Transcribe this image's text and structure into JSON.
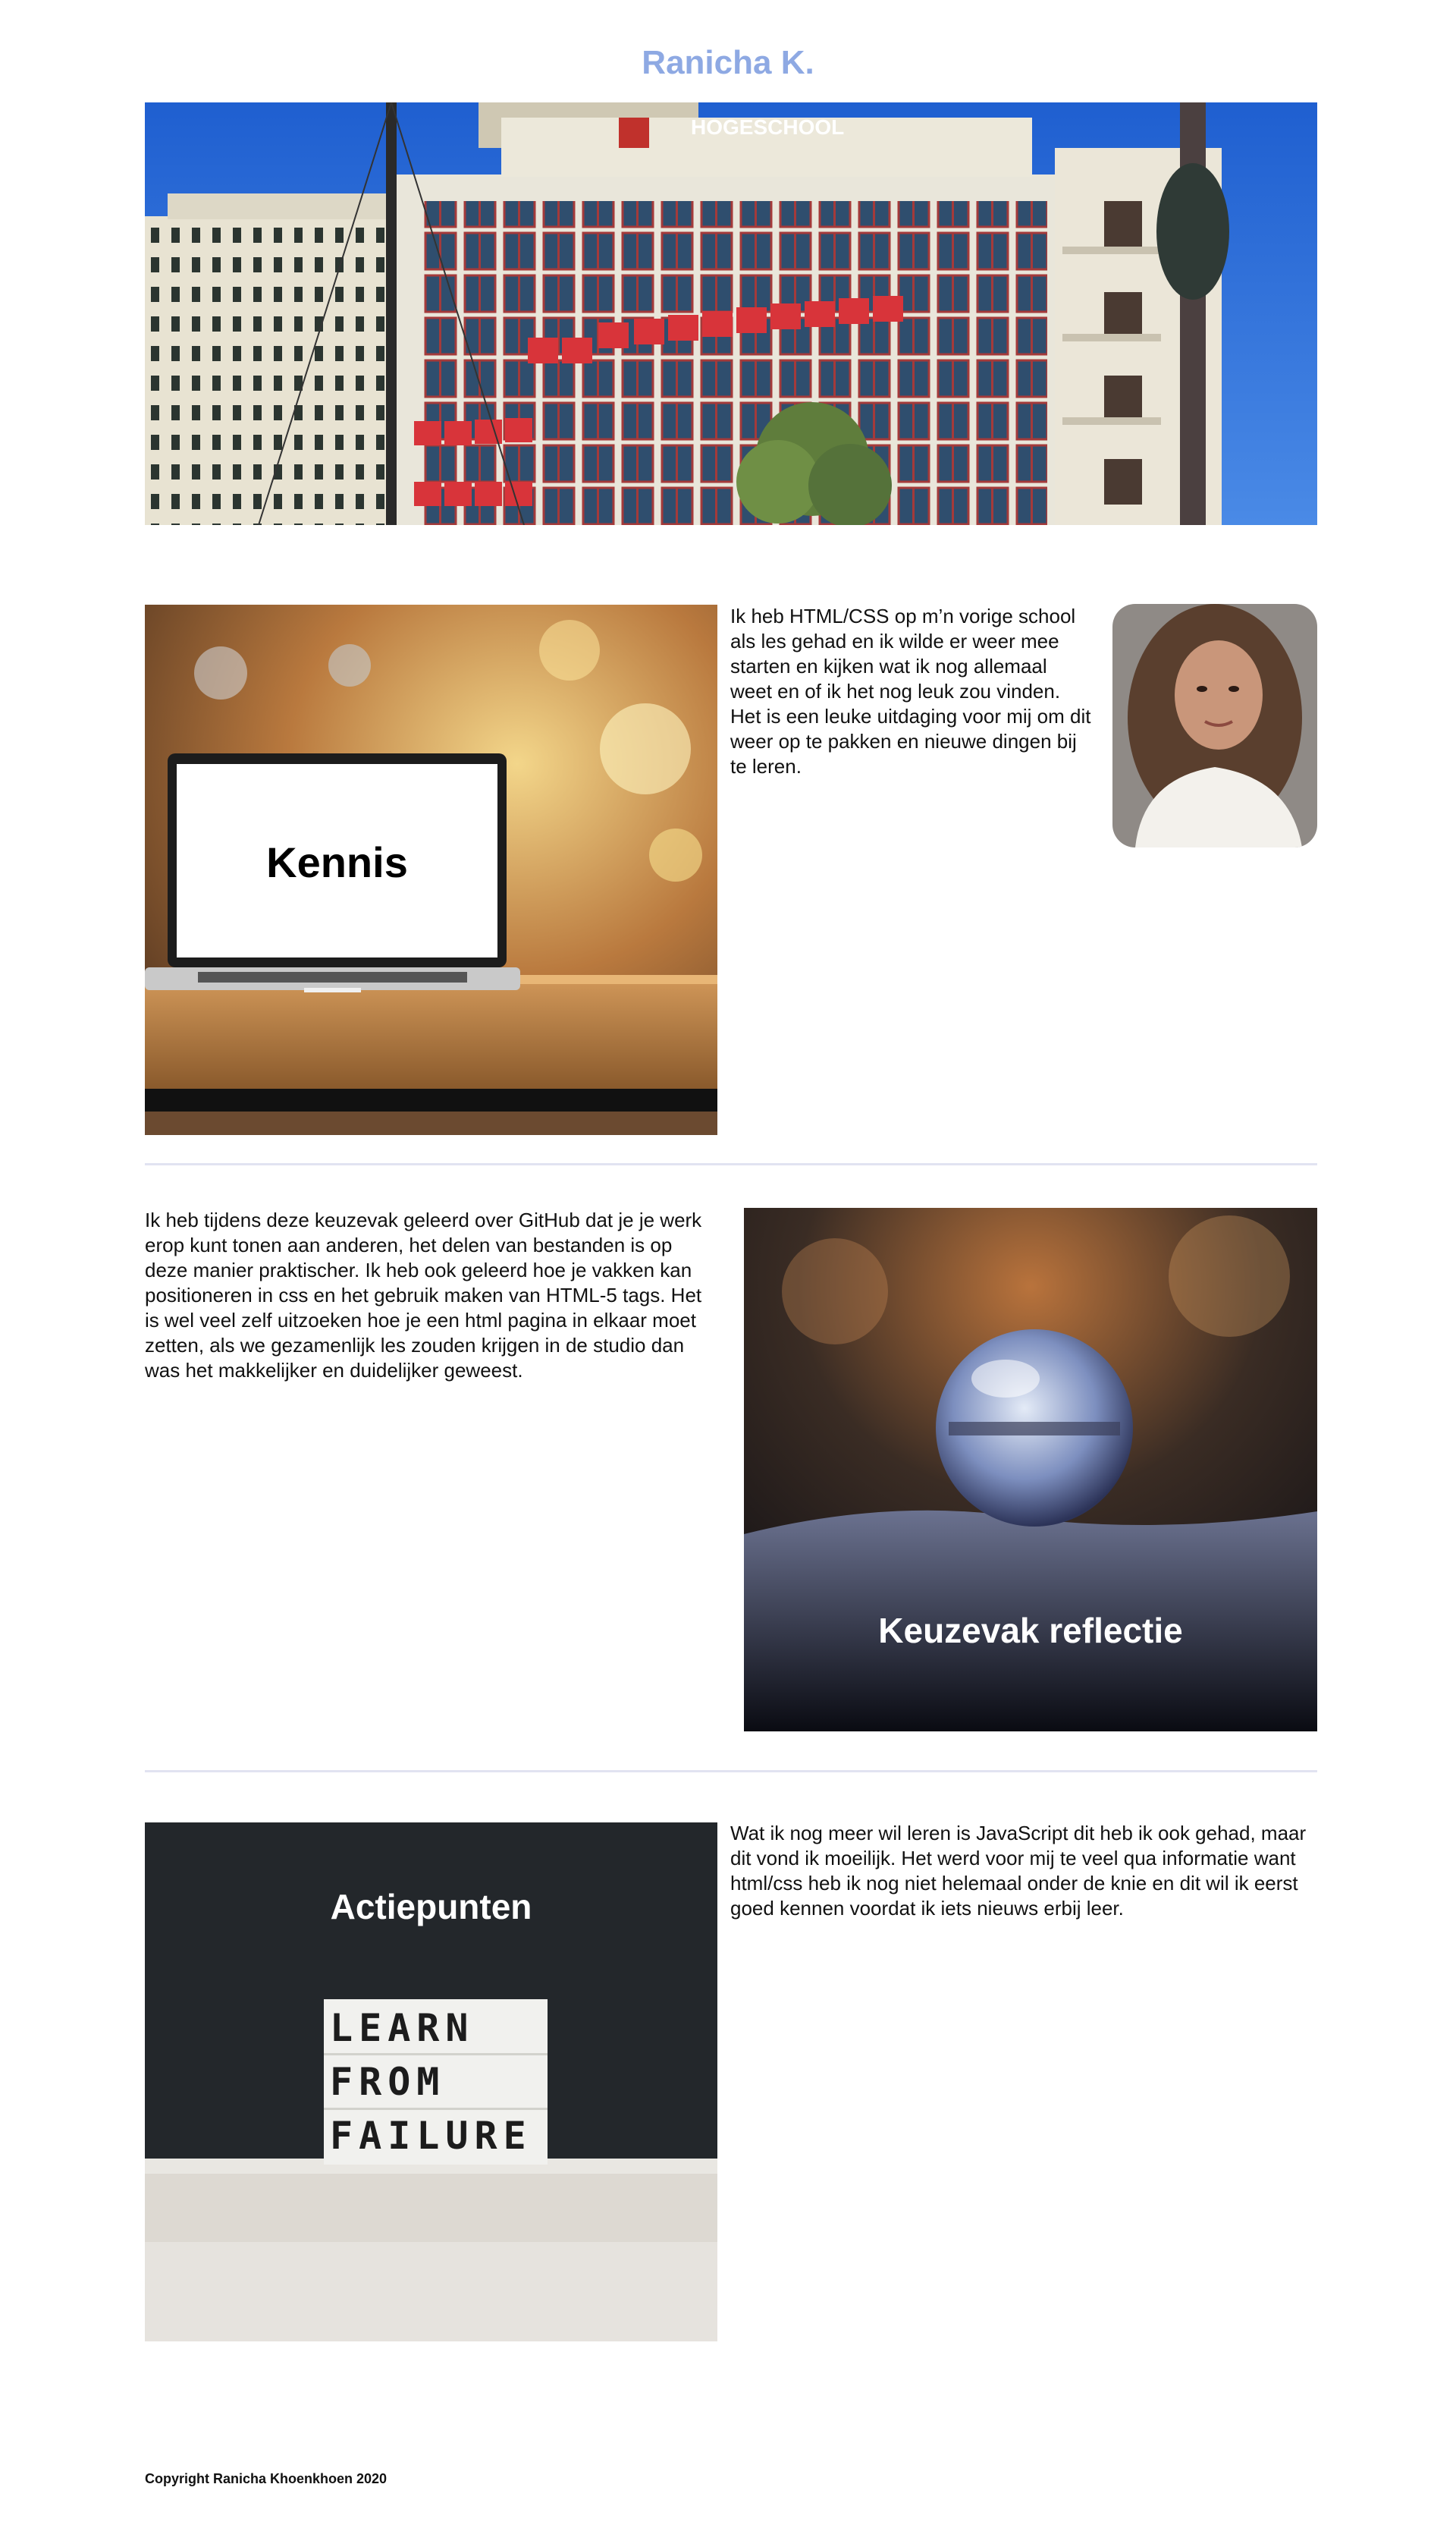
{
  "header": {
    "title": "Ranicha K."
  },
  "hero": {
    "sign_text": "HOGESCHOOL"
  },
  "kennis": {
    "overlay": "Kennis",
    "text": "Ik heb HTML/CSS op m’n vorige school als les gehad en ik wilde er weer mee starten en kijken wat ik nog allemaal weet en of ik het nog leuk zou vinden. Het is een leuke uitdaging voor mij om dit weer op te pakken en nieuwe dingen bij te leren."
  },
  "reflectie": {
    "overlay": "Keuzevak reflectie",
    "text": "Ik heb tijdens deze keuzevak geleerd over GitHub dat je je werk erop kunt tonen aan anderen, het delen van bestanden is op deze manier praktischer. Ik heb ook geleerd hoe je vakken kan positioneren in css en het gebruik maken van HTML-5 tags. Het is wel veel zelf uitzoeken hoe je een html pagina in elkaar moet zetten, als we gezamenlijk les zouden krijgen in de studio dan was het makkelijker en duidelijker geweest."
  },
  "actiepunten": {
    "overlay": "Actiepunten",
    "lightbox_lines": [
      "LEARN",
      "FROM",
      "FAILURE"
    ],
    "text": "Wat ik nog meer wil leren is JavaScript dit heb ik ook gehad, maar dit vond ik moeilijk. Het werd voor mij te veel qua informatie want html/css heb ik nog niet helemaal onder de knie en dit wil ik eerst goed kennen voordat ik iets nieuws erbij leer."
  },
  "footer": {
    "copyright": "Copyright Ranicha Khoenkhoen 2020"
  },
  "colors": {
    "title": "#8ea9e3",
    "divider": "#e1e3f1",
    "text": "#111111"
  }
}
